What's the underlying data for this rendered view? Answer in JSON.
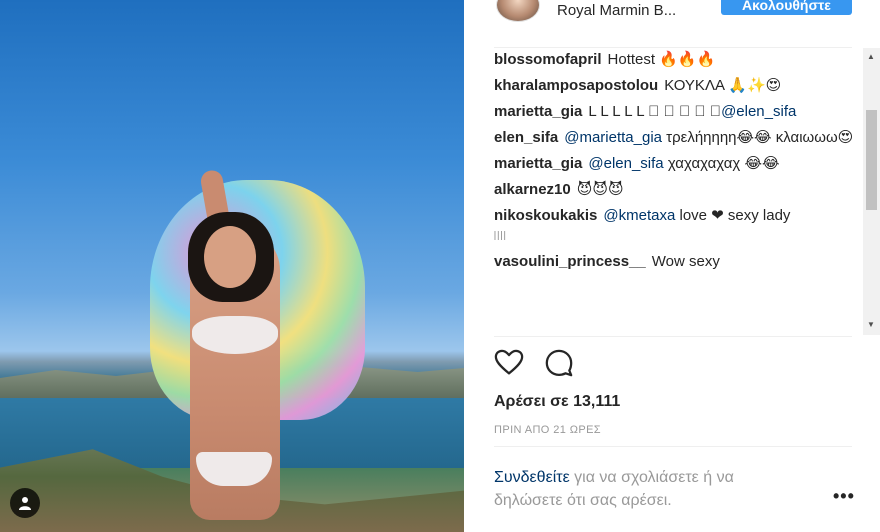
{
  "post": {
    "username": "Royal Marmin B...",
    "follow_label": "Ακολουθήστε"
  },
  "comments": [
    {
      "user": "blossomofapril",
      "text": "Hottest 🔥🔥🔥"
    },
    {
      "user": "kharalamposapostolou",
      "text": "ΚΟΥΚΛΑ 🙏✨😍"
    },
    {
      "user": "marietta_gia",
      "text": "L L L L L ⃒ ⃒ ⃒ ⃒ ⃒",
      "mention": "@elen_sifa"
    },
    {
      "user": "elen_sifa",
      "mention": "@marietta_gia",
      "text": "τρελήηηηη😂😂 κλαιωωω😍"
    },
    {
      "user": "marietta_gia",
      "mention": "@elen_sifa",
      "text": "χαχαχαχαχ 😂😂"
    },
    {
      "user": "alkarnez10",
      "text": "😈😈😈"
    },
    {
      "user": "nikoskoukakis",
      "mention": "@kmetaxa",
      "text": "love ❤ sexy lady",
      "tail": "⃒ ⃒ ⃒ ⃒ ⃒"
    },
    {
      "user": "vasoulini_princess__",
      "text": "Wow sexy"
    }
  ],
  "likes_text": "Αρέσει σε 13,111",
  "time_text": "ΠΡΙΝ ΑΠΟ 21 ΩΡΕΣ",
  "login": {
    "link": "Συνδεθείτε",
    "text": " για να σχολιάσετε ή να δηλώσετε ότι σας αρέσει."
  },
  "more_label": "•••",
  "icons": {
    "like": "heart-icon",
    "comment": "comment-icon",
    "user": "user-icon"
  }
}
